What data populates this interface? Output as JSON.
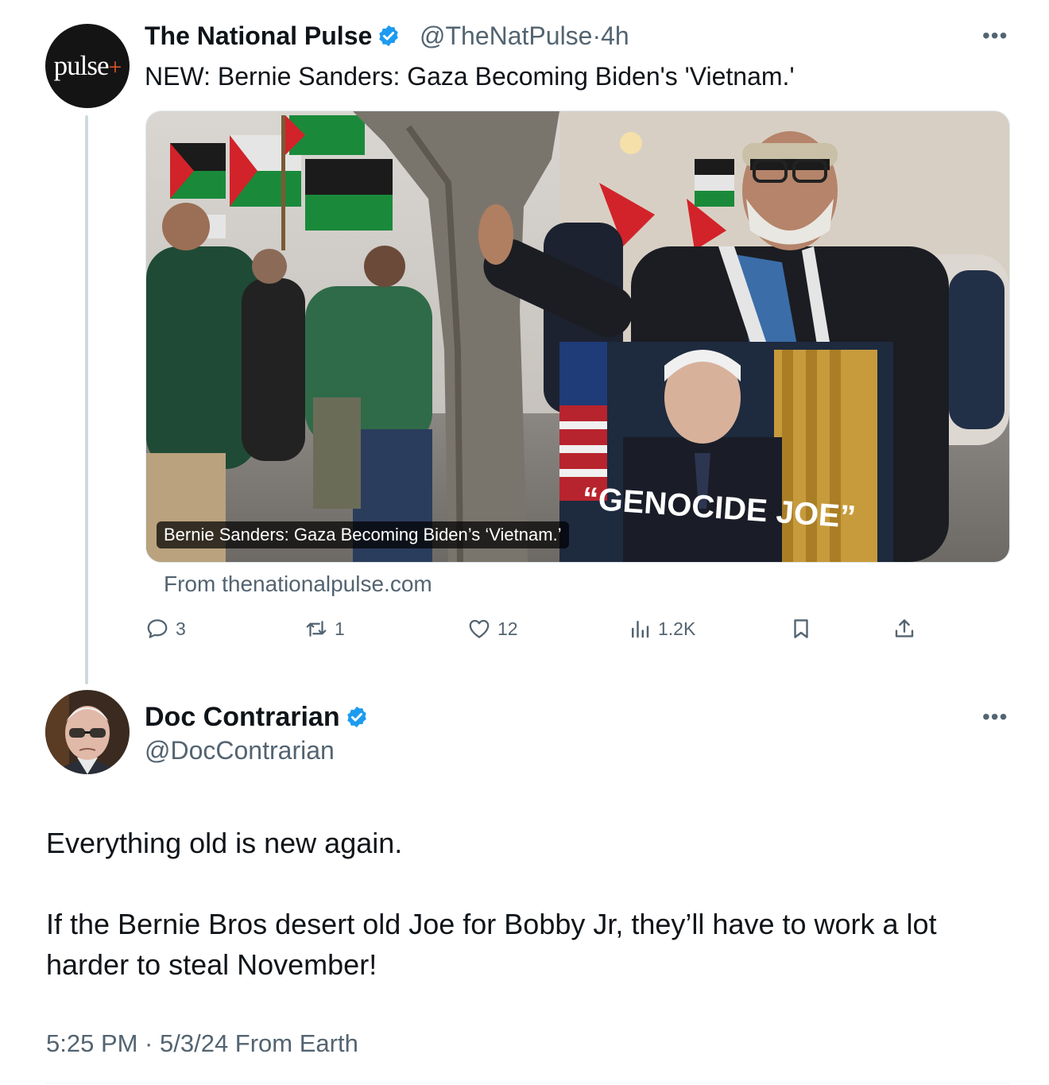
{
  "parent_tweet": {
    "avatar_logo": "pulse+",
    "author_name": "The National Pulse",
    "handle": "@TheNatPulse",
    "time": "4h",
    "separator": "·",
    "more_icon": "more-horizontal-icon",
    "text": "NEW: Bernie Sanders: Gaza Becoming Biden's 'Vietnam.'",
    "card": {
      "caption": "Bernie Sanders: Gaza Becoming Biden’s ‘Vietnam.’",
      "sign_text": "“GENOCIDE JOE”",
      "source": "From thenationalpulse.com"
    },
    "actions": {
      "reply_count": "3",
      "retweet_count": "1",
      "like_count": "12",
      "views_count": "1.2K"
    }
  },
  "tweet": {
    "author_name": "Doc Contrarian",
    "handle": "@DocContrarian",
    "paragraph_1": "Everything old is new again.",
    "paragraph_2": "If the Bernie Bros desert old Joe for Bobby Jr, they’ll have to work a lot harder to steal November!",
    "timestamp": "5:25 PM · 5/3/24 From Earth"
  },
  "colors": {
    "text": "#0f1419",
    "secondary": "#536471",
    "verified": "#1d9bf0",
    "thread_line": "#cfd9de"
  }
}
